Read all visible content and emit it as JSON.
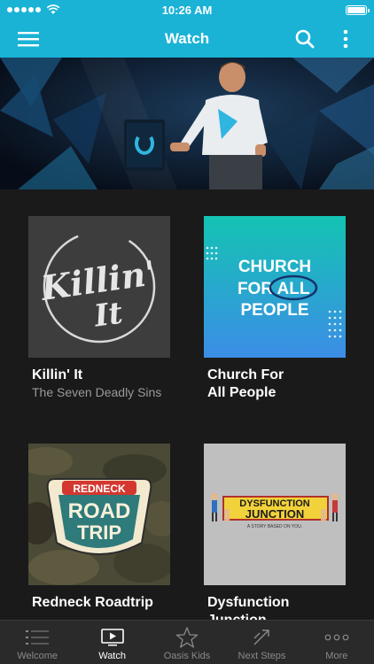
{
  "status_bar": {
    "time": "10:26 AM"
  },
  "nav": {
    "title": "Watch",
    "menu_icon": "hamburger-menu-icon",
    "search_icon": "search-icon",
    "more_icon": "vertical-dots-icon"
  },
  "hero": {
    "image": "speaker-on-stage-photo"
  },
  "series": [
    {
      "title": "Killin' It",
      "subtitle": "The Seven Deadly Sins",
      "art_text_1": "Killin'",
      "art_text_2": "It"
    },
    {
      "title": "Church For\nAll People",
      "subtitle": "",
      "art_line_1": "CHURCH",
      "art_line_2a": "FOR",
      "art_line_2b": "ALL",
      "art_line_3": "PEOPLE"
    },
    {
      "title": "Redneck Roadtrip",
      "subtitle": "",
      "art_top": "REDNECK",
      "art_mid": "ROAD",
      "art_bot": "TRIP"
    },
    {
      "title": "Dysfunction\nJunction",
      "subtitle": "",
      "art_top": "DYSFUNCTION",
      "art_mid": "JUNCTION",
      "art_tag": "A STORY BASED ON YOU."
    }
  ],
  "tabs": [
    {
      "label": "Welcome",
      "icon": "list-icon",
      "active": false
    },
    {
      "label": "Watch",
      "icon": "play-screen-icon",
      "active": true
    },
    {
      "label": "Oasis Kids",
      "icon": "star-icon",
      "active": false
    },
    {
      "label": "Next Steps",
      "icon": "arrows-icon",
      "active": false
    },
    {
      "label": "More",
      "icon": "horizontal-dots-icon",
      "active": false
    }
  ],
  "colors": {
    "accent": "#1ab3d6",
    "background": "#1a1a1a",
    "tabbar": "#2a2a2a"
  }
}
